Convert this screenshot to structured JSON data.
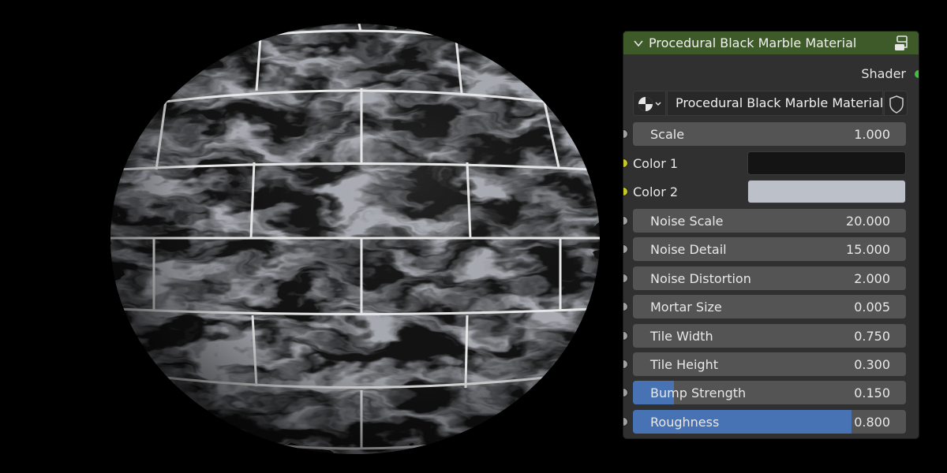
{
  "viewport": {
    "background": "#000000",
    "object": "sphere with procedural black marble tile material"
  },
  "node": {
    "title": "Procedural Black Marble Material",
    "header_color": "#3f5a29",
    "output_label": "Shader",
    "output_socket_color": "#3ec13e",
    "material_name": "Procedural Black Marble Material",
    "params": {
      "scale": {
        "label": "Scale",
        "value": "1.000"
      },
      "color1": {
        "label": "Color 1",
        "color": "#141414"
      },
      "color2": {
        "label": "Color 2",
        "color": "#bcc0c8"
      },
      "noise_scale": {
        "label": "Noise Scale",
        "value": "20.000"
      },
      "noise_detail": {
        "label": "Noise Detail",
        "value": "15.000"
      },
      "noise_distortion": {
        "label": "Noise Distortion",
        "value": "2.000"
      },
      "mortar_size": {
        "label": "Mortar Size",
        "value": "0.005"
      },
      "tile_width": {
        "label": "Tile Width",
        "value": "0.750"
      },
      "tile_height": {
        "label": "Tile Height",
        "value": "0.300"
      },
      "bump_strength": {
        "label": "Bump Strength",
        "value": "0.150",
        "fill_fraction": 0.15
      },
      "roughness": {
        "label": "Roughness",
        "value": "0.800",
        "fill_fraction": 0.8
      }
    },
    "slider_fill_color": "#4772b3"
  }
}
